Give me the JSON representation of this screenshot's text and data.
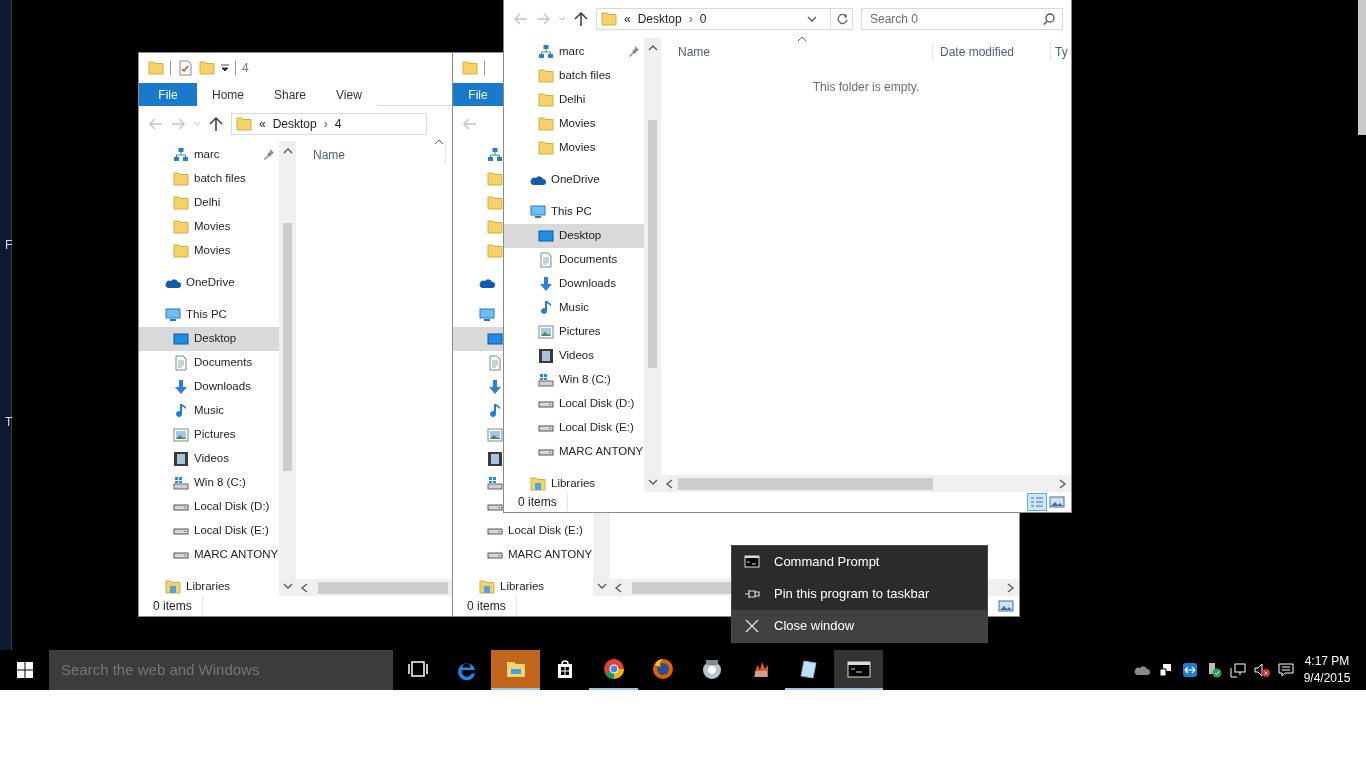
{
  "edge_window": {
    "texts": [
      "F",
      "T"
    ]
  },
  "windows": [
    {
      "title": "4",
      "ribbon_tabs": [
        {
          "kind": "file",
          "label": "File"
        },
        {
          "kind": "tab",
          "label": "Home"
        },
        {
          "kind": "tab",
          "label": "Share"
        },
        {
          "kind": "tab",
          "label": "View"
        }
      ],
      "address": [
        {
          "kind": "overflow",
          "text": "«"
        },
        {
          "kind": "folder",
          "text": "Desktop"
        },
        {
          "kind": "separator",
          "text": "›"
        },
        {
          "kind": "folder",
          "text": "4"
        }
      ],
      "columns": [
        "Name"
      ],
      "quick_access": [
        {
          "kind": "network",
          "label": "marc",
          "pinned": true,
          "selected": false
        },
        {
          "kind": "folder",
          "label": "batch files",
          "pinned": false,
          "selected": false
        },
        {
          "kind": "folder",
          "label": "Delhi",
          "pinned": false,
          "selected": false
        },
        {
          "kind": "folder",
          "label": "Movies",
          "pinned": false,
          "selected": false
        },
        {
          "kind": "folder",
          "label": "Movies",
          "pinned": false,
          "selected": false
        }
      ],
      "nav": [
        {
          "kind": "onedrive",
          "label": "OneDrive",
          "selected": false
        },
        {
          "kind": "pc",
          "label": "This PC",
          "selected": false,
          "children": [
            {
              "kind": "desktop",
              "label": "Desktop",
              "selected": true
            },
            {
              "kind": "documents",
              "label": "Documents",
              "selected": false
            },
            {
              "kind": "downloads",
              "label": "Downloads",
              "selected": false
            },
            {
              "kind": "music",
              "label": "Music",
              "selected": false
            },
            {
              "kind": "pictures",
              "label": "Pictures",
              "selected": false
            },
            {
              "kind": "videos",
              "label": "Videos",
              "selected": false
            },
            {
              "kind": "windrive",
              "label": "Win 8 (C:)",
              "selected": false
            },
            {
              "kind": "disk",
              "label": "Local Disk (D:)",
              "selected": false
            },
            {
              "kind": "disk",
              "label": "Local Disk (E:)",
              "selected": false
            },
            {
              "kind": "disk",
              "label": "MARC ANTONY",
              "selected": false
            }
          ]
        },
        {
          "kind": "libraries",
          "label": "Libraries",
          "selected": false
        }
      ],
      "status": "0 items"
    },
    {
      "ribbon_tabs": [
        {
          "kind": "file",
          "label": "File"
        }
      ],
      "quick_access": [
        {
          "kind": "network",
          "selected": false
        },
        {
          "kind": "folder",
          "selected": false
        },
        {
          "kind": "folder",
          "selected": false
        },
        {
          "kind": "folder",
          "selected": false
        },
        {
          "kind": "folder",
          "selected": false
        }
      ],
      "nav": [
        {
          "kind": "onedrive",
          "selected": false
        },
        {
          "kind": "pc",
          "selected": false,
          "children": [
            {
              "kind": "desktop",
              "selected": true
            },
            {
              "kind": "documents",
              "selected": false
            },
            {
              "kind": "downloads",
              "selected": false
            },
            {
              "kind": "music",
              "selected": false
            },
            {
              "kind": "pictures",
              "selected": false
            },
            {
              "kind": "videos",
              "selected": false
            },
            {
              "kind": "windrive",
              "selected": false
            },
            {
              "kind": "disk",
              "selected": false
            },
            {
              "kind": "disk",
              "label": "Local Disk (E:)",
              "selected": false
            },
            {
              "kind": "disk",
              "label": "MARC ANTONY",
              "selected": false
            }
          ]
        },
        {
          "kind": "libraries",
          "label": "Libraries",
          "selected": false
        }
      ],
      "status": "0 items",
      "view_buttons": [
        {
          "kind": "large-icons",
          "selected": false
        }
      ]
    },
    {
      "address": [
        {
          "kind": "overflow",
          "text": "«"
        },
        {
          "kind": "folder",
          "text": "Desktop"
        },
        {
          "kind": "separator",
          "text": "›"
        },
        {
          "kind": "folder",
          "text": "0"
        }
      ],
      "search": {
        "placeholder": "Search 0"
      },
      "columns": [
        "Name",
        "Date modified",
        "Ty"
      ],
      "empty_message": "This folder is empty.",
      "quick_access": [
        {
          "kind": "network",
          "label": "marc",
          "pinned": true,
          "selected": false
        },
        {
          "kind": "folder",
          "label": "batch files",
          "pinned": false,
          "selected": false
        },
        {
          "kind": "folder",
          "label": "Delhi",
          "pinned": false,
          "selected": false
        },
        {
          "kind": "folder",
          "label": "Movies",
          "pinned": false,
          "selected": false
        },
        {
          "kind": "folder",
          "label": "Movies",
          "pinned": false,
          "selected": false
        }
      ],
      "nav": [
        {
          "kind": "onedrive",
          "label": "OneDrive",
          "selected": false
        },
        {
          "kind": "pc",
          "label": "This PC",
          "selected": false,
          "children": [
            {
              "kind": "desktop",
              "label": "Desktop",
              "selected": true
            },
            {
              "kind": "documents",
              "label": "Documents",
              "selected": false
            },
            {
              "kind": "downloads",
              "label": "Downloads",
              "selected": false
            },
            {
              "kind": "music",
              "label": "Music",
              "selected": false
            },
            {
              "kind": "pictures",
              "label": "Pictures",
              "selected": false
            },
            {
              "kind": "videos",
              "label": "Videos",
              "selected": false
            },
            {
              "kind": "windrive",
              "label": "Win 8 (C:)",
              "selected": false
            },
            {
              "kind": "disk",
              "label": "Local Disk (D:)",
              "selected": false
            },
            {
              "kind": "disk",
              "label": "Local Disk (E:)",
              "selected": false
            },
            {
              "kind": "disk",
              "label": "MARC ANTONY",
              "selected": false
            }
          ]
        },
        {
          "kind": "libraries",
          "label": "Libraries",
          "selected": false
        }
      ],
      "status": "0 items",
      "view_buttons": [
        {
          "kind": "details",
          "selected": true
        },
        {
          "kind": "large-icons",
          "selected": false
        }
      ]
    }
  ],
  "context_menu": [
    {
      "kind": "cmd",
      "label": "Command Prompt",
      "highlighted": false
    },
    {
      "kind": "pin",
      "label": "Pin this program to taskbar",
      "highlighted": false
    },
    {
      "kind": "close",
      "label": "Close window",
      "highlighted": true
    }
  ],
  "taskbar": {
    "search": {
      "placeholder": "Search the web and Windows"
    },
    "apps": [
      {
        "kind": "task-view",
        "flashing": false,
        "hovered": false,
        "running": false
      },
      {
        "kind": "edge",
        "flashing": false,
        "hovered": false,
        "running": false
      },
      {
        "kind": "explorer",
        "flashing": true,
        "hovered": false,
        "running": true
      },
      {
        "kind": "store",
        "flashing": false,
        "hovered": false,
        "running": false
      },
      {
        "kind": "chrome",
        "flashing": false,
        "hovered": false,
        "running": true
      },
      {
        "kind": "firefox",
        "flashing": false,
        "hovered": false,
        "running": false
      },
      {
        "kind": "disc-utility",
        "flashing": false,
        "hovered": false,
        "running": false
      },
      {
        "kind": "burner",
        "flashing": false,
        "hovered": false,
        "running": false
      },
      {
        "kind": "notepad",
        "flashing": false,
        "hovered": false,
        "running": true
      },
      {
        "kind": "cmd",
        "flashing": false,
        "hovered": true,
        "running": true
      }
    ],
    "tray": [
      {
        "kind": "onedrive"
      },
      {
        "kind": "devices"
      },
      {
        "kind": "remote"
      },
      {
        "kind": "usb"
      },
      {
        "kind": "network"
      },
      {
        "kind": "volume-muted"
      },
      {
        "kind": "action-center"
      }
    ],
    "clock": {
      "time": "4:17 PM",
      "date": "9/4/2015"
    }
  }
}
